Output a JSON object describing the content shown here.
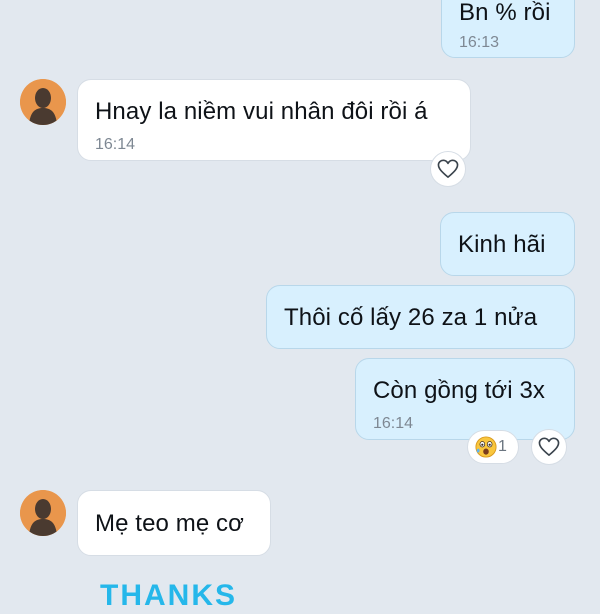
{
  "messages": [
    {
      "text": "Bn % rồi",
      "time": "16:13"
    },
    {
      "text": "Hnay la niềm vui nhân đôi rồi á",
      "time": "16:14"
    },
    {
      "text": "Kinh hãi"
    },
    {
      "text": "Thôi cố lấy 26 za 1 nửa"
    },
    {
      "text": "Còn gồng tới 3x",
      "time": "16:14"
    },
    {
      "text": "Mẹ teo mẹ cơ"
    }
  ],
  "reactions": {
    "message_5_emoji_count": "1",
    "emoji": "surprised-face-emoji"
  },
  "sticker": {
    "text": "THANKS"
  },
  "colors": {
    "background": "#e2e8ef",
    "incoming_bubble": "#ffffff",
    "outgoing_bubble": "#d8f0fe",
    "timestamp": "#7e8893",
    "avatar": "#e9964c",
    "sticker": "#25b7ea"
  },
  "icons": [
    "heart-outline-icon",
    "avatar-silhouette-icon"
  ]
}
